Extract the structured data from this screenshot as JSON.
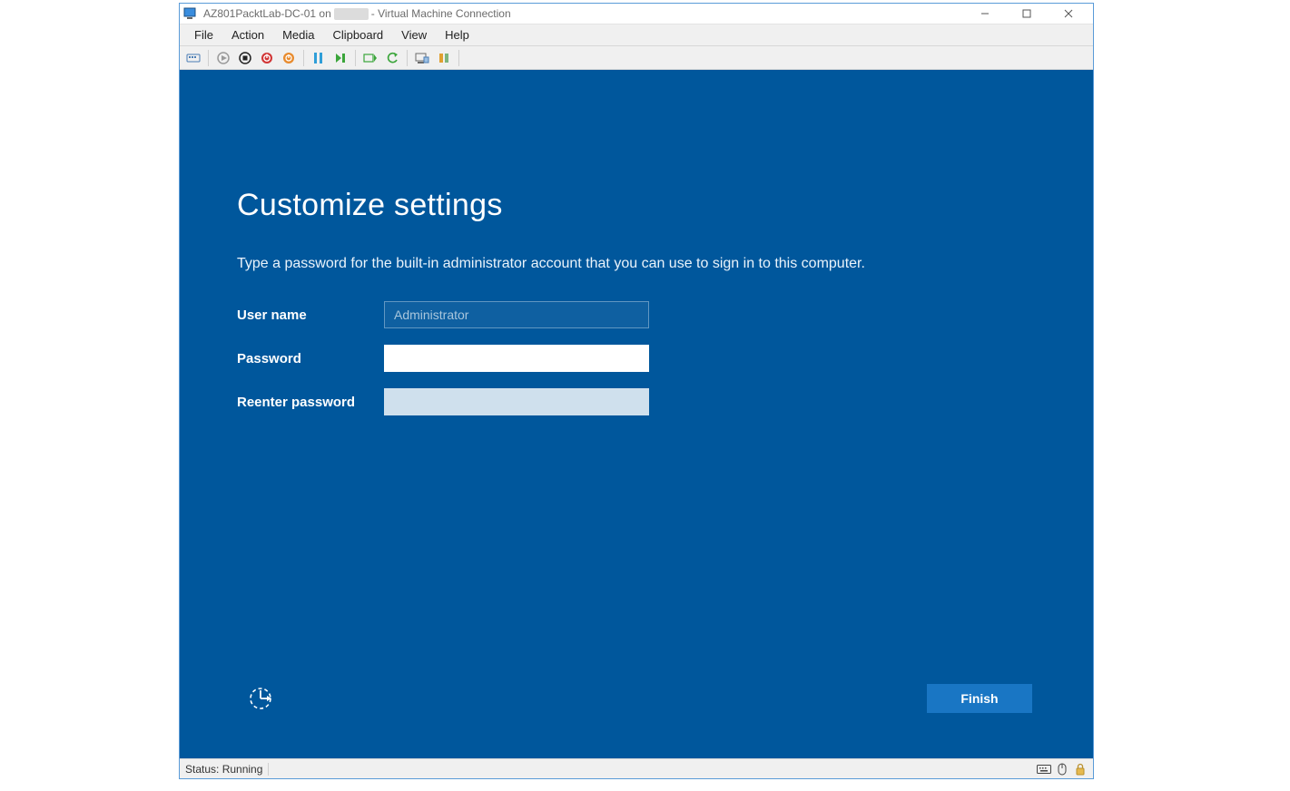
{
  "titlebar": {
    "prefix": "AZ801PacktLab-DC-01 on ",
    "suffix": " - Virtual Machine Connection"
  },
  "menu": {
    "file": "File",
    "action": "Action",
    "media": "Media",
    "clipboard": "Clipboard",
    "view": "View",
    "help": "Help"
  },
  "oobe": {
    "heading": "Customize settings",
    "subtitle": "Type a password for the built-in administrator account that you can use to sign in to this computer.",
    "username_label": "User name",
    "username_value": "Administrator",
    "password_label": "Password",
    "password_value": "",
    "reenter_label": "Reenter password",
    "reenter_value": "",
    "finish_label": "Finish"
  },
  "status": {
    "text": "Status: Running"
  }
}
